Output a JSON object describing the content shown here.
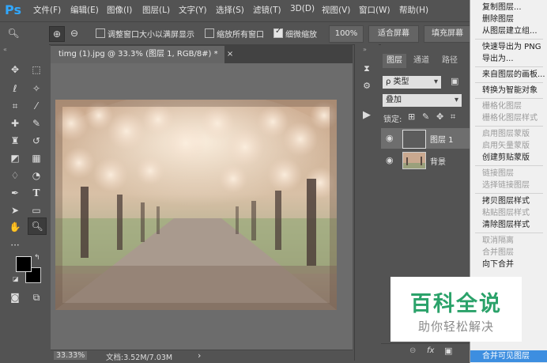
{
  "app": {
    "logo": "Ps",
    "menus": [
      "文件(F)",
      "编辑(E)",
      "图像(I)",
      "图层(L)",
      "文字(Y)",
      "选择(S)",
      "滤镜(T)",
      "3D(D)",
      "视图(V)",
      "窗口(W)",
      "帮助(H)"
    ]
  },
  "options": {
    "resize_windows_label": "调整窗口大小以满屏显示",
    "resize_windows_checked": false,
    "zoom_all_label": "缩放所有窗口",
    "zoom_all_checked": false,
    "scrubby_label": "细微缩放",
    "scrubby_checked": true,
    "btn_100": "100%",
    "btn_fit": "适合屏幕",
    "btn_fill": "填充屏幕"
  },
  "document": {
    "tab_title": "timg (1).jpg @ 33.3% (图层 1, RGB/8#) *",
    "tab_close": "×",
    "zoom": "33.33%",
    "doc_info": "文档:3.52M/7.03M",
    "status_arrow": "›"
  },
  "layers_panel": {
    "tabs": [
      "图层",
      "通道",
      "路径"
    ],
    "filter_label": "ρ 类型",
    "blend_mode": "叠加",
    "lock_label": "锁定:",
    "layers": [
      {
        "name": "图层 1",
        "visible": true,
        "selected": true
      },
      {
        "name": "背景",
        "visible": true,
        "selected": false
      }
    ],
    "footer": [
      "⊖",
      "fx",
      "▣"
    ]
  },
  "context_menu": {
    "items": [
      {
        "label": "复制图层...",
        "enabled": true
      },
      {
        "label": "删除图层",
        "enabled": true
      },
      {
        "label": "从图层建立组...",
        "enabled": true
      },
      {
        "sep": true
      },
      {
        "label": "快速导出为 PNG",
        "enabled": true
      },
      {
        "label": "导出为...",
        "enabled": true
      },
      {
        "sep": true
      },
      {
        "label": "来自图层的画板...",
        "enabled": true
      },
      {
        "sep": true
      },
      {
        "label": "转换为智能对象",
        "enabled": true
      },
      {
        "sep": true
      },
      {
        "label": "栅格化图层",
        "enabled": false
      },
      {
        "label": "栅格化图层样式",
        "enabled": false
      },
      {
        "sep": true
      },
      {
        "label": "启用图层蒙版",
        "enabled": false
      },
      {
        "label": "启用矢量蒙版",
        "enabled": false
      },
      {
        "label": "创建剪贴蒙版",
        "enabled": true
      },
      {
        "sep": true
      },
      {
        "label": "链接图层",
        "enabled": false
      },
      {
        "label": "选择链接图层",
        "enabled": false
      },
      {
        "sep": true
      },
      {
        "label": "拷贝图层样式",
        "enabled": true
      },
      {
        "label": "粘贴图层样式",
        "enabled": false
      },
      {
        "label": "清除图层样式",
        "enabled": true
      },
      {
        "sep": true
      },
      {
        "label": "取消隔离",
        "enabled": false
      },
      {
        "label": "合并图层",
        "enabled": false
      },
      {
        "label": "向下合并",
        "enabled": true
      },
      {
        "label": "合并可见图层",
        "enabled": true,
        "highlighted": true
      }
    ]
  },
  "watermark": {
    "title": "百科全说",
    "subtitle": "助你轻松解决"
  }
}
